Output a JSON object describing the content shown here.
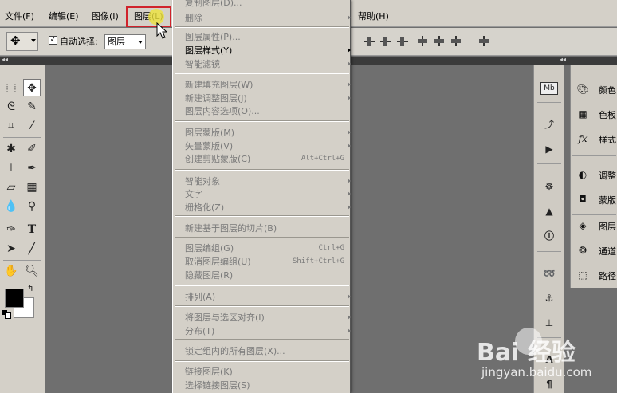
{
  "menubar": {
    "file": "文件(F)",
    "edit": "编辑(E)",
    "image": "图像(I)",
    "layer": "图层(L)",
    "help": "帮助(H)"
  },
  "options_bar": {
    "autoselect_label": "自动选择:",
    "autoselect_value": "图层"
  },
  "layer_menu": {
    "items": [
      {
        "label": "复制图层(D)...",
        "enabled": false
      },
      {
        "label": "删除",
        "enabled": false,
        "submenu": true
      },
      {
        "label": "图层属性(P)...",
        "enabled": false
      },
      {
        "label": "图层样式(Y)",
        "enabled": true,
        "submenu": true
      },
      {
        "label": "智能滤镜",
        "enabled": false,
        "submenu": true
      },
      {
        "label": "新建填充图层(W)",
        "enabled": false,
        "submenu": true
      },
      {
        "label": "新建调整图层(J)",
        "enabled": false,
        "submenu": true
      },
      {
        "label": "图层内容选项(O)...",
        "enabled": false
      },
      {
        "label": "图层蒙版(M)",
        "enabled": false,
        "submenu": true
      },
      {
        "label": "矢量蒙版(V)",
        "enabled": false,
        "submenu": true
      },
      {
        "label": "创建剪贴蒙版(C)",
        "enabled": false,
        "shortcut": "Alt+Ctrl+G"
      },
      {
        "label": "智能对象",
        "enabled": false,
        "submenu": true
      },
      {
        "label": "文字",
        "enabled": false,
        "submenu": true
      },
      {
        "label": "栅格化(Z)",
        "enabled": false,
        "submenu": true
      },
      {
        "label": "新建基于图层的切片(B)",
        "enabled": false
      },
      {
        "label": "图层编组(G)",
        "enabled": false,
        "shortcut": "Ctrl+G"
      },
      {
        "label": "取消图层编组(U)",
        "enabled": false,
        "shortcut": "Shift+Ctrl+G"
      },
      {
        "label": "隐藏图层(R)",
        "enabled": false
      },
      {
        "label": "排列(A)",
        "enabled": false,
        "submenu": true
      },
      {
        "label": "将图层与选区对齐(I)",
        "enabled": false,
        "submenu": true
      },
      {
        "label": "分布(T)",
        "enabled": false,
        "submenu": true
      },
      {
        "label": "锁定组内的所有图层(X)...",
        "enabled": false
      },
      {
        "label": "链接图层(K)",
        "enabled": false
      },
      {
        "label": "选择链接图层(S)",
        "enabled": false
      }
    ]
  },
  "dock": {
    "panels": [
      {
        "label": "颜色",
        "icon": "palette-icon"
      },
      {
        "label": "色板",
        "icon": "swatches-icon"
      },
      {
        "label": "样式",
        "icon": "fx-icon"
      },
      {
        "label": "调整",
        "icon": "adjustments-icon"
      },
      {
        "label": "蒙版",
        "icon": "masks-icon"
      },
      {
        "label": "图层",
        "icon": "layers-icon"
      },
      {
        "label": "通道",
        "icon": "channels-icon"
      },
      {
        "label": "路径",
        "icon": "paths-icon"
      }
    ]
  },
  "watermark": {
    "logo": "Bai  经验",
    "url": "jingyan.baidu.com"
  },
  "colors": {
    "foreground": "#000000",
    "background": "#ffffff",
    "highlight_box": "#d0222b"
  }
}
